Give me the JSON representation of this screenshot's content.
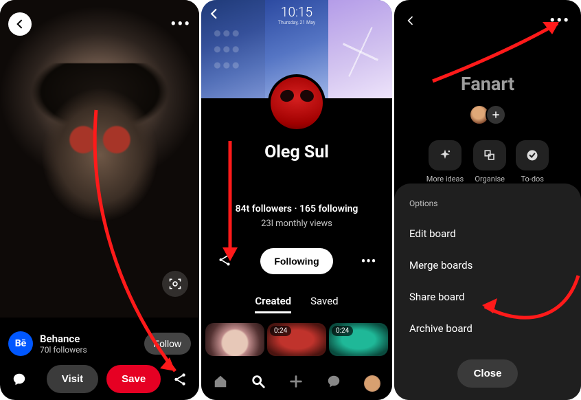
{
  "panel1": {
    "source": {
      "name": "Behance",
      "followers": "70l followers",
      "badge": "Bē"
    },
    "buttons": {
      "follow": "Follow",
      "visit": "Visit",
      "save": "Save"
    }
  },
  "panel2": {
    "clock": "10:15",
    "date": "Thursday, 21 May",
    "name": "Oleg Sul",
    "stats": "84t followers · 165 following",
    "views": "23l monthly views",
    "following_btn": "Following",
    "tabs": {
      "created": "Created",
      "saved": "Saved"
    },
    "durations": [
      "0:24",
      "0:24"
    ]
  },
  "panel3": {
    "title": "Fanart",
    "tools": {
      "more_ideas": "More ideas",
      "organise": "Organise",
      "todos": "To-dos"
    },
    "sheet": {
      "heading": "Options",
      "items": [
        "Edit board",
        "Merge boards",
        "Share board",
        "Archive board"
      ],
      "close": "Close"
    }
  }
}
